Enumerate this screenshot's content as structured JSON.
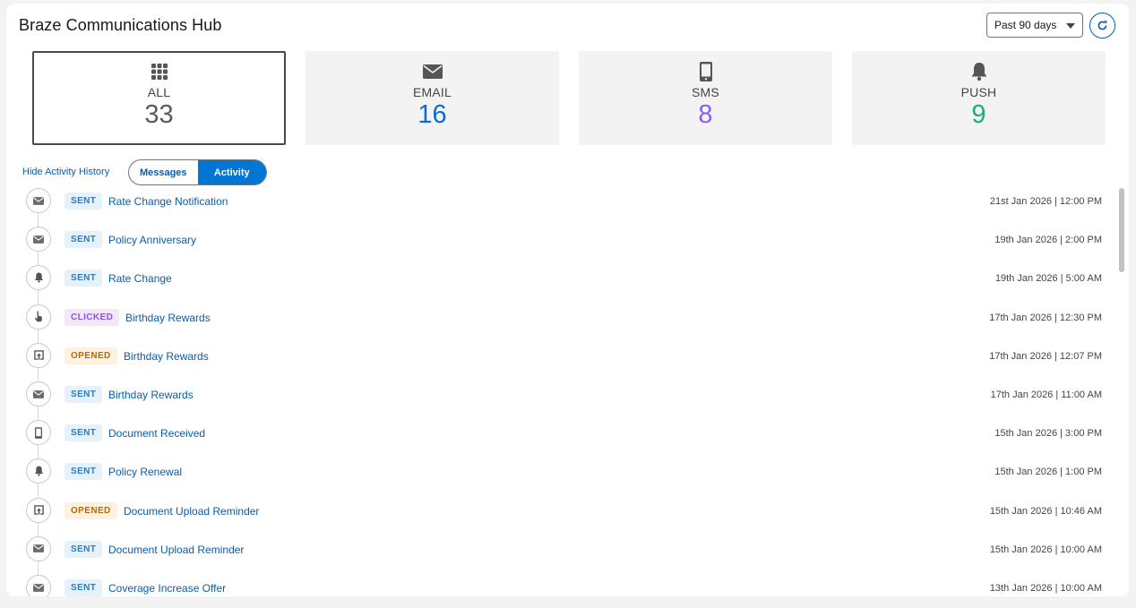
{
  "header": {
    "title": "Braze Communications Hub",
    "period_select": "Past 90 days",
    "refresh_icon": "refresh-icon"
  },
  "tiles": [
    {
      "id": "all",
      "label": "ALL",
      "count": "33",
      "icon": "grid-icon",
      "color": "#5c5c5c"
    },
    {
      "id": "email",
      "label": "EMAIL",
      "count": "16",
      "icon": "envelope-icon",
      "color": "#0b6ad1"
    },
    {
      "id": "sms",
      "label": "SMS",
      "count": "8",
      "icon": "phone-icon",
      "color": "#8b5cf6"
    },
    {
      "id": "push",
      "label": "PUSH",
      "count": "9",
      "icon": "bell-icon",
      "color": "#1bae7c"
    }
  ],
  "controls": {
    "hide_link": "Hide Activity History",
    "toggle": [
      "Messages",
      "Activity"
    ],
    "toggle_selected": "Activity"
  },
  "activity": [
    {
      "icon": "envelope-icon",
      "status": "SENT",
      "title": "Rate Change Notification",
      "time": "21st Jan 2026 | 12:00 PM"
    },
    {
      "icon": "envelope-icon",
      "status": "SENT",
      "title": "Policy Anniversary",
      "time": "19th Jan 2026 | 2:00 PM"
    },
    {
      "icon": "bell-icon",
      "status": "SENT",
      "title": "Rate Change",
      "time": "19th Jan 2026 | 5:00 AM"
    },
    {
      "icon": "pointer-icon",
      "status": "CLICKED",
      "title": "Birthday Rewards",
      "time": "17th Jan 2026 | 12:30 PM"
    },
    {
      "icon": "open-icon",
      "status": "OPENED",
      "title": "Birthday Rewards",
      "time": "17th Jan 2026 | 12:07 PM"
    },
    {
      "icon": "envelope-icon",
      "status": "SENT",
      "title": "Birthday Rewards",
      "time": "17th Jan 2026 | 11:00 AM"
    },
    {
      "icon": "phone-icon",
      "status": "SENT",
      "title": "Document Received",
      "time": "15th Jan 2026 | 3:00 PM"
    },
    {
      "icon": "bell-icon",
      "status": "SENT",
      "title": "Policy Renewal",
      "time": "15th Jan 2026 | 1:00 PM"
    },
    {
      "icon": "open-icon",
      "status": "OPENED",
      "title": "Document Upload Reminder",
      "time": "15th Jan 2026 | 10:46 AM"
    },
    {
      "icon": "envelope-icon",
      "status": "SENT",
      "title": "Document Upload Reminder",
      "time": "15th Jan 2026 | 10:00 AM"
    },
    {
      "icon": "envelope-icon",
      "status": "SENT",
      "title": "Coverage Increase Offer",
      "time": "13th Jan 2026 | 10:00 AM"
    }
  ]
}
